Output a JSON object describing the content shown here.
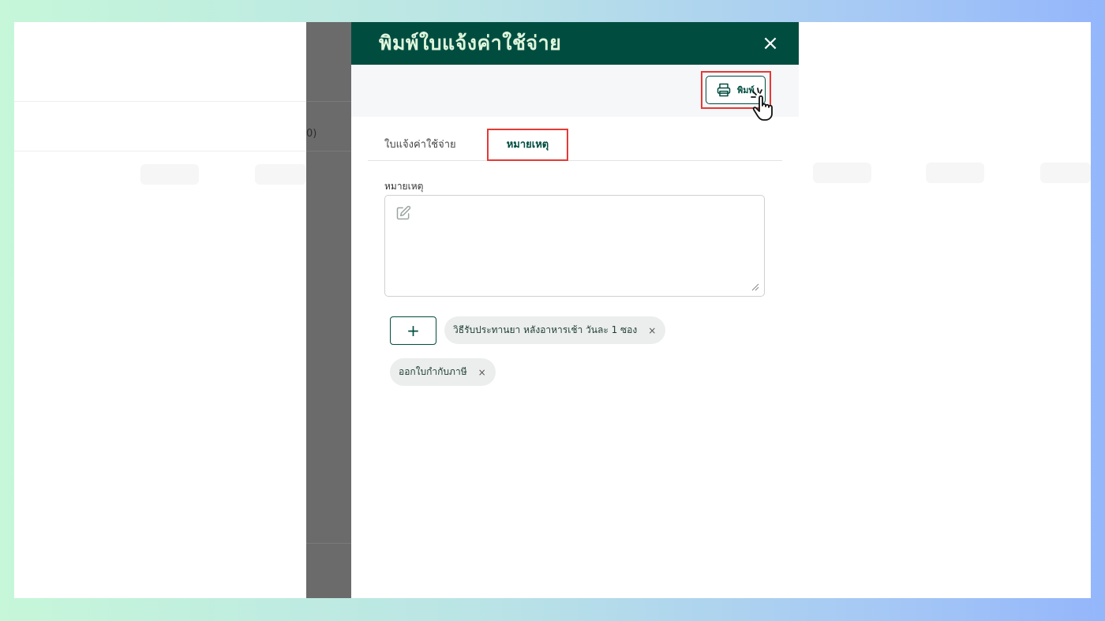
{
  "panel": {
    "title": "พิมพ์ใบแจ้งค่าใช้จ่าย",
    "close_label": "×"
  },
  "toolbar": {
    "print_label": "พิมพ์"
  },
  "background": {
    "partial_text": "0)"
  },
  "tabs": [
    {
      "label": "ใบแจ้งค่าใช้จ่าย",
      "active": false
    },
    {
      "label": "หมายเหตุ",
      "active": true
    }
  ],
  "note": {
    "label": "หมายเหตุ",
    "value": "",
    "placeholder": ""
  },
  "add_button_label": "+",
  "chips": [
    {
      "label": "วิธีรับประทานยา หลังอาหารเช้า วันละ 1 ซอง",
      "remove_label": "×"
    },
    {
      "label": "ออกใบกำกับภาษี",
      "remove_label": "×"
    }
  ],
  "icons": {
    "printer": "printer-icon",
    "cursor": "hand-pointer-icon",
    "edit": "edit-icon",
    "resize": "resize-handle-icon"
  },
  "colors": {
    "header_bg": "#004d40",
    "accent": "#004d40",
    "highlight": "#e53935"
  }
}
